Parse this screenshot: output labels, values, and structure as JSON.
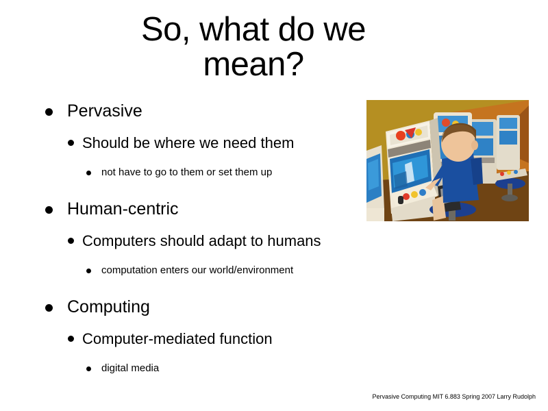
{
  "slide": {
    "title": "So, what do we\nmean?",
    "background_color": "#ffffff",
    "text_color": "#000000",
    "bullets": [
      {
        "level": 1,
        "text": "Pervasive"
      },
      {
        "level": 2,
        "text": "Should be where we need them"
      },
      {
        "level": 3,
        "text": "not have to go to them or set them up"
      },
      {
        "level": 1,
        "text": "Human-centric"
      },
      {
        "level": 2,
        "text": "Computers should adapt to humans"
      },
      {
        "level": 3,
        "text": "computation enters our world/environment"
      },
      {
        "level": 1,
        "text": "Computing"
      },
      {
        "level": 2,
        "text": "Computer-mediated function"
      },
      {
        "level": 3,
        "text": "digital media"
      }
    ],
    "photo": {
      "alt": "Child in blue shirt playing at a row of arcade game cabinets in a yellow and orange room",
      "wall_color": "#b58f22",
      "wall_accent_color": "#7a4a16",
      "cabinet_color": "#ece4d2",
      "screen_color": "#2d8fd4",
      "shirt_color": "#1a4fa0",
      "stool_color": "#1c3f8f"
    },
    "footer": "Pervasive Computing MIT 6.883 Spring 2007  Larry Rudolph"
  }
}
